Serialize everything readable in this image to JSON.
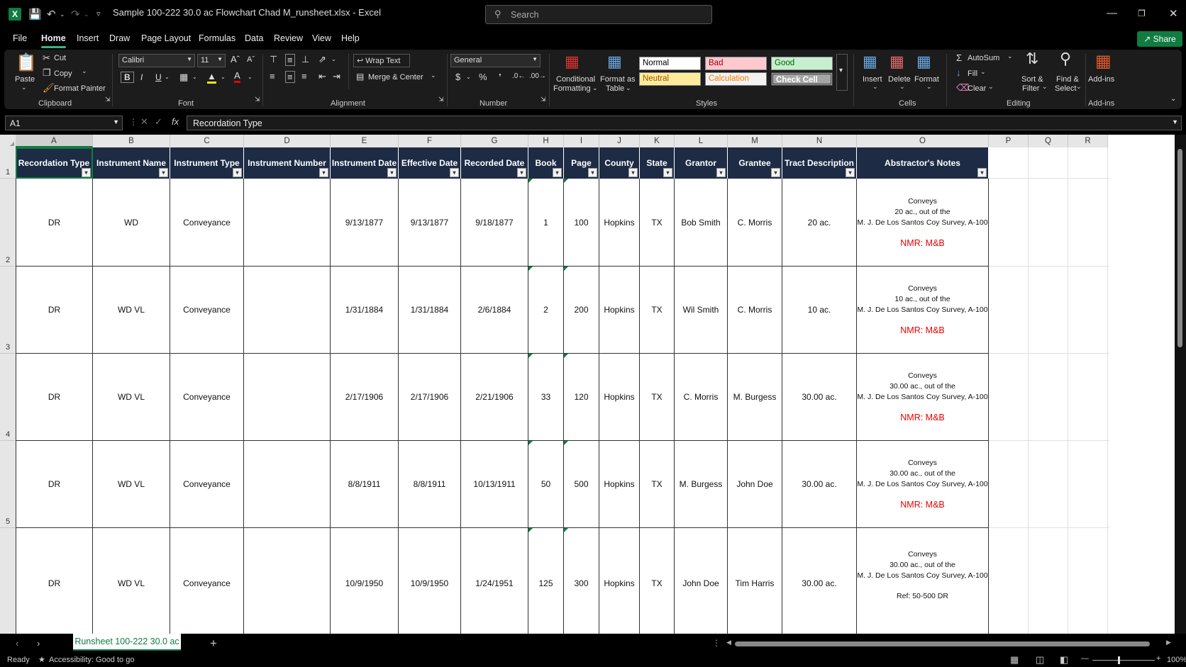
{
  "titlebar": {
    "filename": "Sample 100-222 30.0 ac Flowchart Chad M_runsheet.xlsx",
    "separator": "-",
    "app": "Excel",
    "search_placeholder": "Search"
  },
  "menu": [
    "File",
    "Home",
    "Insert",
    "Draw",
    "Page Layout",
    "Formulas",
    "Data",
    "Review",
    "View",
    "Help"
  ],
  "share_label": "Share",
  "ribbon": {
    "clipboard": {
      "paste": "Paste",
      "cut": "Cut",
      "copy": "Copy",
      "format_painter": "Format Painter",
      "group": "Clipboard"
    },
    "font": {
      "name": "Calibri",
      "size": "11",
      "group": "Font"
    },
    "alignment": {
      "wrap": "Wrap Text",
      "merge": "Merge & Center",
      "group": "Alignment"
    },
    "number": {
      "format": "General",
      "group": "Number"
    },
    "styles": {
      "conditional_1": "Conditional",
      "conditional_2": "Formatting",
      "format_table_1": "Format as",
      "format_table_2": "Table",
      "normal": "Normal",
      "bad": "Bad",
      "good": "Good",
      "neutral": "Neutral",
      "calculation": "Calculation",
      "check": "Check Cell",
      "group": "Styles"
    },
    "cells": {
      "insert": "Insert",
      "delete": "Delete",
      "format": "Format",
      "group": "Cells"
    },
    "editing": {
      "autosum": "AutoSum",
      "fill": "Fill",
      "clear": "Clear",
      "sort_1": "Sort &",
      "sort_2": "Filter",
      "find_1": "Find &",
      "find_2": "Select",
      "group": "Editing"
    },
    "addins": {
      "label": "Add-ins",
      "group": "Add-ins"
    }
  },
  "formula_bar": {
    "name_box": "A1",
    "fx": "fx",
    "value": "Recordation Type"
  },
  "columns": [
    "A",
    "B",
    "C",
    "D",
    "E",
    "F",
    "G",
    "H",
    "I",
    "J",
    "K",
    "L",
    "M",
    "N",
    "O",
    "P",
    "Q",
    "R"
  ],
  "row_numbers": [
    "1",
    "2",
    "3",
    "4",
    "5"
  ],
  "headers": [
    "Recordation Type",
    "Instrument Name",
    "Instrument Type",
    "Instrument Number",
    "Instrument Date",
    "Effective Date",
    "Recorded Date",
    "Book",
    "Page",
    "County",
    "State",
    "Grantor",
    "Grantee",
    "Tract Description",
    "Abstractor's Notes"
  ],
  "rows": [
    {
      "type": "DR",
      "name": "WD",
      "itype": "Conveyance",
      "num": "",
      "idate": "9/13/1877",
      "edate": "9/13/1877",
      "rdate": "9/18/1877",
      "book": "1",
      "page": "100",
      "county": "Hopkins",
      "state": "TX",
      "grantor": "Bob Smith",
      "grantee": "C. Morris",
      "tract": "20 ac.",
      "n1": "Conveys",
      "n2": "20 ac., out of the",
      "n3": "M. J. De Los Santos Coy Survey, A-100",
      "n4": "NMR: M&B"
    },
    {
      "type": "DR",
      "name": "WD VL",
      "itype": "Conveyance",
      "num": "",
      "idate": "1/31/1884",
      "edate": "1/31/1884",
      "rdate": "2/6/1884",
      "book": "2",
      "page": "200",
      "county": "Hopkins",
      "state": "TX",
      "grantor": "Wil Smith",
      "grantee": "C. Morris",
      "tract": "10 ac.",
      "n1": "Conveys",
      "n2": "10 ac., out of the",
      "n3": "M. J. De Los Santos Coy Survey, A-100",
      "n4": "NMR: M&B"
    },
    {
      "type": "DR",
      "name": "WD VL",
      "itype": "Conveyance",
      "num": "",
      "idate": "2/17/1906",
      "edate": "2/17/1906",
      "rdate": "2/21/1906",
      "book": "33",
      "page": "120",
      "county": "Hopkins",
      "state": "TX",
      "grantor": "C. Morris",
      "grantee": "M. Burgess",
      "tract": "30.00 ac.",
      "n1": "Conveys",
      "n2": "30.00 ac., out of the",
      "n3": "M. J. De Los Santos Coy Survey, A-100",
      "n4": "NMR: M&B"
    },
    {
      "type": "DR",
      "name": "WD VL",
      "itype": "Conveyance",
      "num": "",
      "idate": "8/8/1911",
      "edate": "8/8/1911",
      "rdate": "10/13/1911",
      "book": "50",
      "page": "500",
      "county": "Hopkins",
      "state": "TX",
      "grantor": "M. Burgess",
      "grantee": "John Doe",
      "tract": "30.00 ac.",
      "n1": "Conveys",
      "n2": "30.00 ac., out of the",
      "n3": "M. J. De Los Santos Coy Survey, A-100",
      "n4": "NMR: M&B"
    },
    {
      "type": "DR",
      "name": "WD VL",
      "itype": "Conveyance",
      "num": "",
      "idate": "10/9/1950",
      "edate": "10/9/1950",
      "rdate": "1/24/1951",
      "book": "125",
      "page": "300",
      "county": "Hopkins",
      "state": "TX",
      "grantor": "John Doe",
      "grantee": "Tim Harris",
      "tract": "30.00 ac.",
      "n1": "Conveys",
      "n2": "30.00 ac., out of the",
      "n3": "M. J. De Los Santos Coy Survey, A-100",
      "n4": "Ref: 50-500 DR"
    }
  ],
  "sheet_tab": "Runsheet 100-222 30.0 ac",
  "add_sheet": "+",
  "status": {
    "ready": "Ready",
    "accessibility": "Accessibility: Good to go",
    "zoom": "100%"
  }
}
